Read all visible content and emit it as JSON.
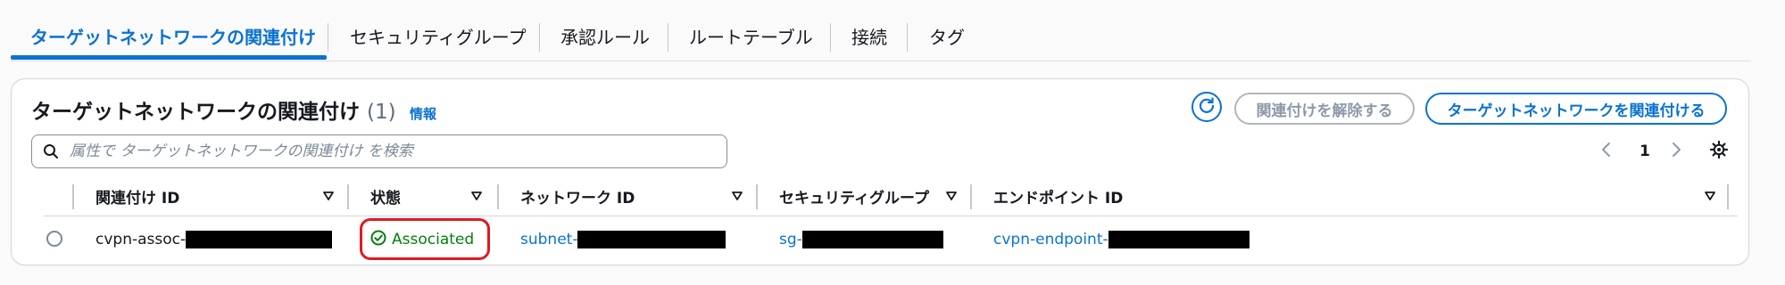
{
  "tabs": [
    {
      "label": "ターゲットネットワークの関連付け",
      "active": true
    },
    {
      "label": "セキュリティグループ"
    },
    {
      "label": "承認ルール"
    },
    {
      "label": "ルートテーブル"
    },
    {
      "label": "接続"
    },
    {
      "label": "タグ"
    }
  ],
  "panel": {
    "title": "ターゲットネットワークの関連付け",
    "count": "(1)",
    "info": "情報",
    "disassociate_label": "関連付けを解除する",
    "associate_label": "ターゲットネットワークを関連付ける",
    "search_placeholder": "属性で ターゲットネットワークの関連付け を検索",
    "page_number": "1"
  },
  "table": {
    "columns": [
      "関連付け ID",
      "状態",
      "ネットワーク ID",
      "セキュリティグループ",
      "エンドポイント ID"
    ],
    "rows": [
      {
        "association_id": "cvpn-assoc-",
        "status": "Associated",
        "network_id": "subnet-",
        "security_group": "sg-",
        "endpoint_id": "cvpn-endpoint-"
      }
    ]
  },
  "colors": {
    "accent": "#0972d3",
    "success": "#037f0c",
    "highlight": "#e0191e"
  }
}
